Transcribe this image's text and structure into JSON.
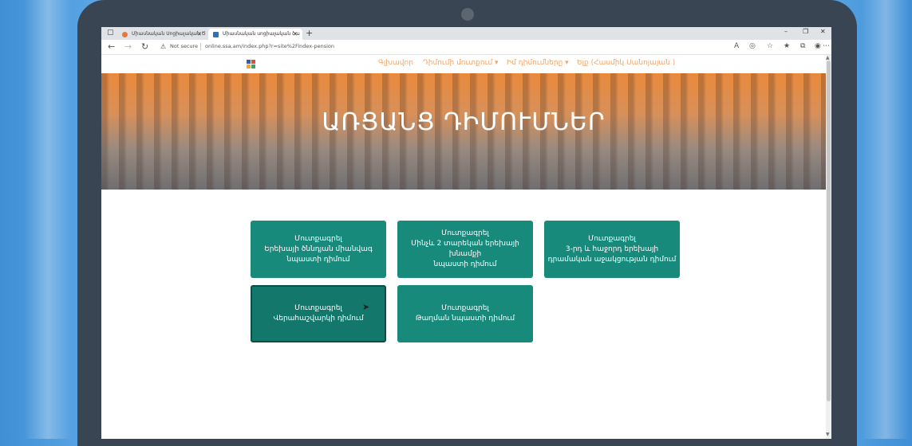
{
  "browser": {
    "tabs": [
      {
        "title": "Միասնական Սոցիալական Ծ",
        "active": false
      },
      {
        "title": "Միասնական սոցիալական ծա",
        "active": true
      }
    ],
    "security_label": "Not secure",
    "url": "online.ssa.am/index.php?r=site%2Findex-pension"
  },
  "site_nav": {
    "items": [
      "Գլխավոր",
      "Դիմումի մուտքում ▾",
      "Իմ դիմումները ▾",
      "Ելք (Հասմիկ Սանոյայան )"
    ]
  },
  "hero": {
    "title": "ԱՌՑԱՆՑ ԴԻՄՈՒՄՆԵՐ"
  },
  "cards": [
    {
      "line1": "Մուտքագրել",
      "line2": "Երեխայի ծննդյան միանվագ",
      "line3": "նպաստի դիմում"
    },
    {
      "line1": "Մուտքագրել",
      "line2": "Մինչև 2 տարեկան երեխայի խնամքի",
      "line3": "նպաստի դիմում"
    },
    {
      "line1": "Մուտքագրել",
      "line2": "3-րդ և հաջորդ երեխայի",
      "line3": "դրամական աջակցության դիմում"
    },
    {
      "line1": "Մուտքագրել",
      "line2": "Վերահաշվարկի դիմում"
    },
    {
      "line1": "Մուտքագրել",
      "line2": "Թաղման նպաստի դիմում"
    }
  ],
  "colors": {
    "card": "#178a7c",
    "nav_link": "#f2a46a",
    "laptop_frame": "#394553"
  }
}
